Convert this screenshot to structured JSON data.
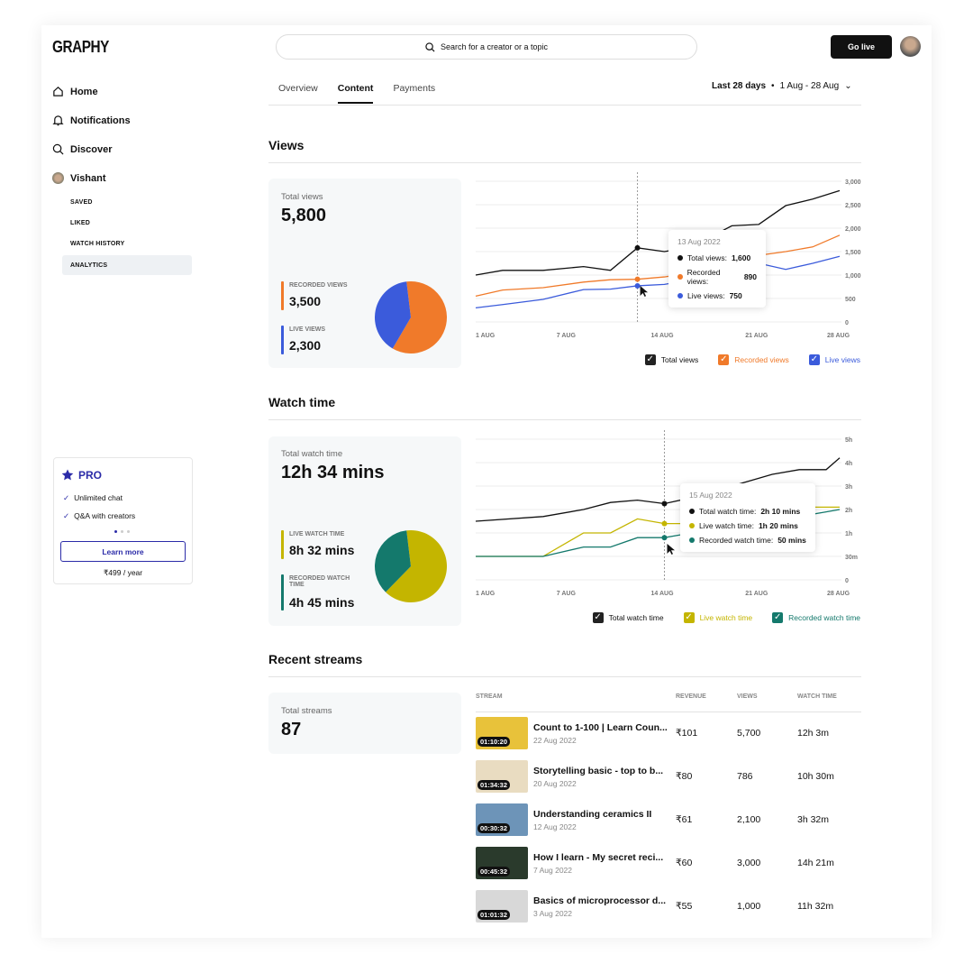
{
  "app": {
    "logo": "GRAPHY",
    "search_placeholder": "Search for a creator or a topic",
    "go_live": "Go live"
  },
  "sidebar": {
    "items": [
      {
        "label": "Home",
        "icon": "home-icon"
      },
      {
        "label": "Notifications",
        "icon": "bell-icon"
      },
      {
        "label": "Discover",
        "icon": "search-icon"
      },
      {
        "label": "Vishant",
        "icon": "avatar"
      }
    ],
    "sub_items": [
      "SAVED",
      "LIKED",
      "WATCH HISTORY",
      "ANALYTICS"
    ],
    "active_sub": "ANALYTICS"
  },
  "pro": {
    "title": "PRO",
    "features": [
      "Unlimited chat",
      "Q&A with creators"
    ],
    "cta": "Learn more",
    "price": "₹499 / year"
  },
  "tabs": [
    {
      "label": "Overview"
    },
    {
      "label": "Content",
      "active": true
    },
    {
      "label": "Payments"
    }
  ],
  "range": {
    "label": "Last 28 days",
    "dates": "1 Aug - 28 Aug"
  },
  "views": {
    "title": "Views",
    "total_label": "Total views",
    "total": "5,800",
    "recorded_label": "RECORDED VIEWS",
    "recorded": "3,500",
    "live_label": "LIVE VIEWS",
    "live": "2,300",
    "tooltip": {
      "date": "13 Aug 2022",
      "rows": [
        {
          "k": "Total views:",
          "v": "1,600"
        },
        {
          "k": "Recorded views:",
          "v": "890"
        },
        {
          "k": "Live views:",
          "v": "750"
        }
      ]
    }
  },
  "watch": {
    "title": "Watch time",
    "total_label": "Total watch time",
    "total": "12h 34 mins",
    "live_label": "LIVE WATCH TIME",
    "live": "8h 32 mins",
    "recorded_label": "RECORDED WATCH TIME",
    "recorded": "4h 45 mins",
    "tooltip": {
      "date": "15 Aug 2022",
      "rows": [
        {
          "k": "Total watch time:",
          "v": "2h 10 mins"
        },
        {
          "k": "Live watch time:",
          "v": "1h 20 mins"
        },
        {
          "k": "Recorded watch time:",
          "v": "50 mins"
        }
      ]
    }
  },
  "chart_data": [
    {
      "type": "line",
      "xlabel": "",
      "ylabel": "",
      "x_ticks": [
        "1 AUG",
        "7 AUG",
        "14 AUG",
        "21 AUG",
        "28 AUG"
      ],
      "y_ticks": [
        "0",
        "500",
        "1,000",
        "1,500",
        "2,000",
        "2,500",
        "3,000"
      ],
      "ylim": [
        0,
        3000
      ],
      "grid": true,
      "legend": "bottom-right",
      "x": [
        1,
        3,
        6,
        9,
        11,
        13,
        15,
        17,
        20,
        22,
        24,
        26,
        28
      ],
      "series": [
        {
          "name": "Total views",
          "color": "#111111",
          "values": [
            1000,
            1100,
            1100,
            1180,
            1100,
            1580,
            1500,
            1600,
            2050,
            2080,
            2480,
            2620,
            2800
          ]
        },
        {
          "name": "Recorded views",
          "color": "#f07a2a",
          "values": [
            550,
            680,
            730,
            850,
            900,
            910,
            960,
            1050,
            1200,
            1420,
            1500,
            1600,
            1850
          ]
        },
        {
          "name": "Live views",
          "color": "#3b5bdb",
          "values": [
            300,
            370,
            480,
            690,
            700,
            770,
            800,
            900,
            1300,
            1250,
            1120,
            1250,
            1400
          ]
        }
      ]
    },
    {
      "type": "line",
      "xlabel": "",
      "ylabel": "",
      "x_ticks": [
        "1 AUG",
        "7 AUG",
        "14 AUG",
        "21 AUG",
        "28 AUG"
      ],
      "y_ticks": [
        "0",
        "30m",
        "1h",
        "2h",
        "3h",
        "4h",
        "5h"
      ],
      "grid": true,
      "legend": "bottom-right",
      "x": [
        1,
        6,
        9,
        11,
        13,
        15,
        17,
        20,
        23,
        25,
        27,
        28
      ],
      "series": [
        {
          "name": "Total watch time",
          "color": "#111111",
          "values": [
            1.5,
            1.7,
            2.0,
            2.3,
            2.4,
            2.25,
            2.5,
            3.0,
            3.5,
            3.7,
            3.7,
            4.2
          ]
        },
        {
          "name": "Live watch time",
          "color": "#c4b500",
          "values": [
            0.5,
            0.5,
            1.0,
            1.0,
            1.6,
            1.4,
            1.4,
            1.8,
            2.1,
            2.1,
            2.1,
            2.1
          ]
        },
        {
          "name": "Recorded watch time",
          "color": "#14796c",
          "values": [
            0.5,
            0.5,
            0.7,
            0.7,
            0.9,
            0.9,
            1.0,
            1.1,
            1.5,
            1.7,
            1.9,
            2.0
          ]
        }
      ]
    },
    {
      "type": "pie",
      "values": [
        3500,
        2300
      ],
      "labels": [
        "Recorded views",
        "Live views"
      ],
      "colors": [
        "#f07a2a",
        "#3b5bdb"
      ]
    },
    {
      "type": "pie",
      "values": [
        512,
        285
      ],
      "labels": [
        "Live watch time",
        "Recorded watch time"
      ],
      "colors": [
        "#c4b500",
        "#14796c"
      ]
    }
  ],
  "streams": {
    "title": "Recent streams",
    "total_label": "Total streams",
    "total": "87",
    "headers": [
      "STREAM",
      "REVENUE",
      "VIEWS",
      "WATCH TIME"
    ],
    "rows": [
      {
        "title": "Count to 1-100 | Learn Coun...",
        "date": "22 Aug 2022",
        "duration": "01:10:20",
        "revenue": "₹101",
        "views": "5,700",
        "watch": "12h 3m",
        "thumb": "#e8c23a"
      },
      {
        "title": "Storytelling basic - top to b...",
        "date": "20 Aug 2022",
        "duration": "01:34:32",
        "revenue": "₹80",
        "views": "786",
        "watch": "10h 30m",
        "thumb": "#e9dcc1"
      },
      {
        "title": "Understanding ceramics II",
        "date": "12 Aug 2022",
        "duration": "00:30:32",
        "revenue": "₹61",
        "views": "2,100",
        "watch": "3h 32m",
        "thumb": "#6d94b8"
      },
      {
        "title": "How I learn - My secret reci...",
        "date": "7 Aug 2022",
        "duration": "00:45:32",
        "revenue": "₹60",
        "views": "3,000",
        "watch": "14h 21m",
        "thumb": "#2a3a2c"
      },
      {
        "title": "Basics of microprocessor d...",
        "date": "3 Aug 2022",
        "duration": "01:01:32",
        "revenue": "₹55",
        "views": "1,000",
        "watch": "11h 32m",
        "thumb": "#d8d8d8"
      }
    ]
  }
}
